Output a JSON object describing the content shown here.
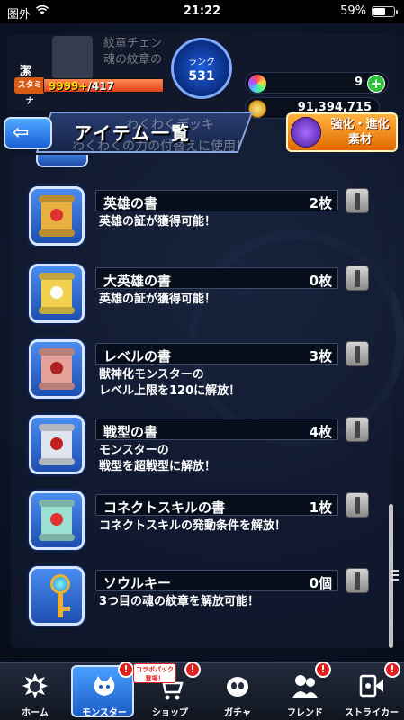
{
  "status_bar": {
    "carrier": "圏外",
    "time": "21:22",
    "battery": "59%"
  },
  "header": {
    "player_name": "潔",
    "stamina_label": "スタミナ",
    "stamina_value": "9999+",
    "stamina_max": "/417",
    "rank_label": "ランク",
    "rank_value": "531",
    "gems": "9",
    "gem_add": "+",
    "gold": "91,394,715",
    "ghost_banner_line1": "紋章チェン",
    "ghost_banner_line2": "魂の紋章の"
  },
  "titlebar": {
    "title": "アイテム一覧",
    "ghost_subtitle_1": "わくわくデッキ",
    "ghost_subtitle_2": "わくわくの力の付替えに使用！",
    "evolve_button": "強化・進化素材"
  },
  "items": [
    {
      "name": "英雄の書",
      "count": "2枚",
      "desc": [
        "英雄の証が獲得可能！"
      ],
      "icon": "hero-book-icon",
      "color": "#e8b040",
      "emblem": "#e03030"
    },
    {
      "name": "大英雄の書",
      "count": "0枚",
      "desc": [
        "英雄の証が獲得可能！"
      ],
      "icon": "great-hero-book-icon",
      "color": "#f2d050",
      "emblem": "#ffffff"
    },
    {
      "name": "レベルの書",
      "count": "3枚",
      "desc": [
        "獣神化モンスターの",
        "レベル上限を120に解放！"
      ],
      "icon": "level-book-icon",
      "color": "#e6a09a",
      "emblem": "#b02020"
    },
    {
      "name": "戦型の書",
      "count": "4枚",
      "desc": [
        "モンスターの",
        "戦型を超戦型に解放！"
      ],
      "icon": "battle-type-book-icon",
      "color": "#dfe4ee",
      "emblem": "#c02020"
    },
    {
      "name": "コネクトスキルの書",
      "count": "1枚",
      "desc": [
        "コネクトスキルの発動条件を解放！"
      ],
      "icon": "connect-skill-book-icon",
      "color": "#9be0d0",
      "emblem": "#e03030"
    },
    {
      "name": "ソウルキー",
      "count": "0個",
      "desc": [
        "3つ目の魂の紋章を解放可能！"
      ],
      "icon": "soul-key-icon"
    }
  ],
  "nav": {
    "tabs": [
      {
        "label": "ホーム",
        "icon": "home-icon"
      },
      {
        "label": "モンスター",
        "icon": "monster-icon"
      },
      {
        "label": "ショップ",
        "icon": "shop-icon"
      },
      {
        "label": "ガチャ",
        "icon": "gacha-icon"
      },
      {
        "label": "フレンド",
        "icon": "friend-icon"
      },
      {
        "label": "ストライカー",
        "icon": "striker-icon"
      }
    ],
    "badge": "!",
    "collab_line1": "コラボパック",
    "collab_line2": "登場！"
  }
}
